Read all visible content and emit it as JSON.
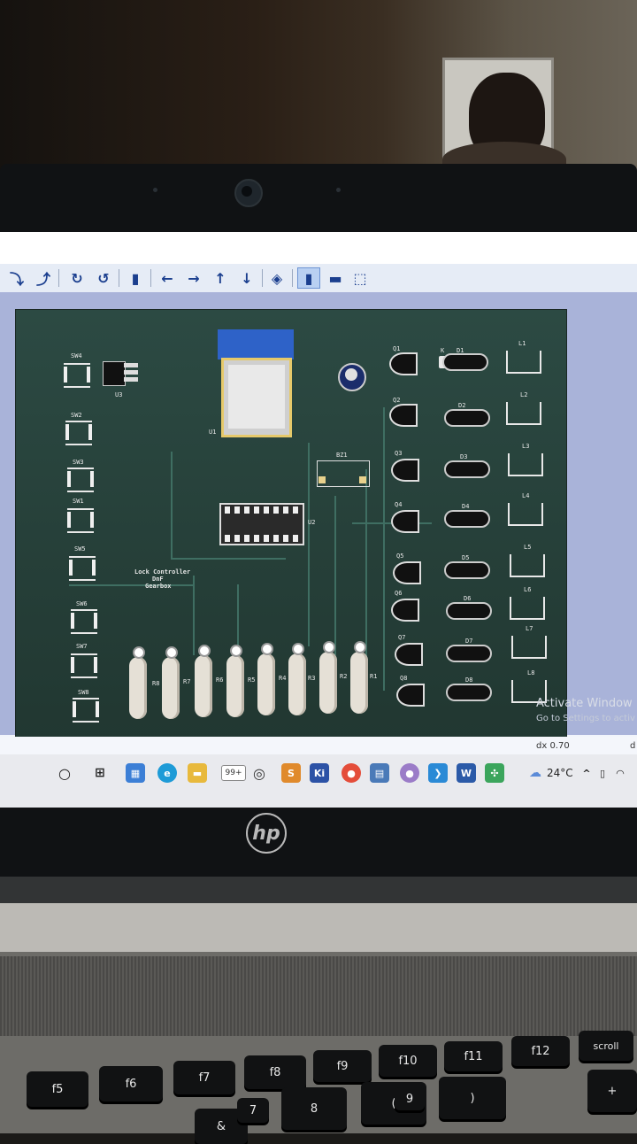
{
  "board": {
    "title_line1": "Lock Controller",
    "title_line2": "DnF",
    "title_line3": "Gearbox",
    "switches": [
      "SW4",
      "SW2",
      "SW3",
      "SW1",
      "SW5",
      "SW6",
      "SW7",
      "SW8"
    ],
    "regulator": "U3",
    "mcu": "U1",
    "ic": "U2",
    "buzzer": "BZ1",
    "transistors": [
      "Q1",
      "Q2",
      "Q3",
      "Q4",
      "Q5",
      "Q6",
      "Q7",
      "Q8"
    ],
    "diodes": [
      "D1",
      "D2",
      "D3",
      "D4",
      "D5",
      "D6",
      "D7",
      "D8"
    ],
    "leds": [
      "L1",
      "L2",
      "L3",
      "L4",
      "L5",
      "L6",
      "L7",
      "L8"
    ],
    "resistors": [
      "R8",
      "R7",
      "R6",
      "R5",
      "R4",
      "R3",
      "R2",
      "R1"
    ],
    "diode_cathode_mark": "K"
  },
  "watermark": {
    "line1": "Activate Window",
    "line2": "Go to Settings to activ"
  },
  "statusbar": {
    "dx": "dx 0.70",
    "trail": "d"
  },
  "taskbar": {
    "badge": "99+",
    "ki_label": "Ki",
    "weather": "24°C"
  },
  "keyboard": {
    "f5": "f5",
    "f6": "f6",
    "f7": "f7",
    "f8": "f8",
    "f9": "f9",
    "f10": "f10",
    "f11": "f11",
    "f12": "f12",
    "scroll": "scroll",
    "seven": "7",
    "eight": "8",
    "nine": "9",
    "ampersand": "&",
    "open_paren": "(",
    "close_paren": ")",
    "plus": "+"
  },
  "brand": "hp",
  "colors": {
    "board": "#253d37",
    "canvas": "#a9b3d9",
    "toolbar_icon": "#1b3f8f"
  }
}
